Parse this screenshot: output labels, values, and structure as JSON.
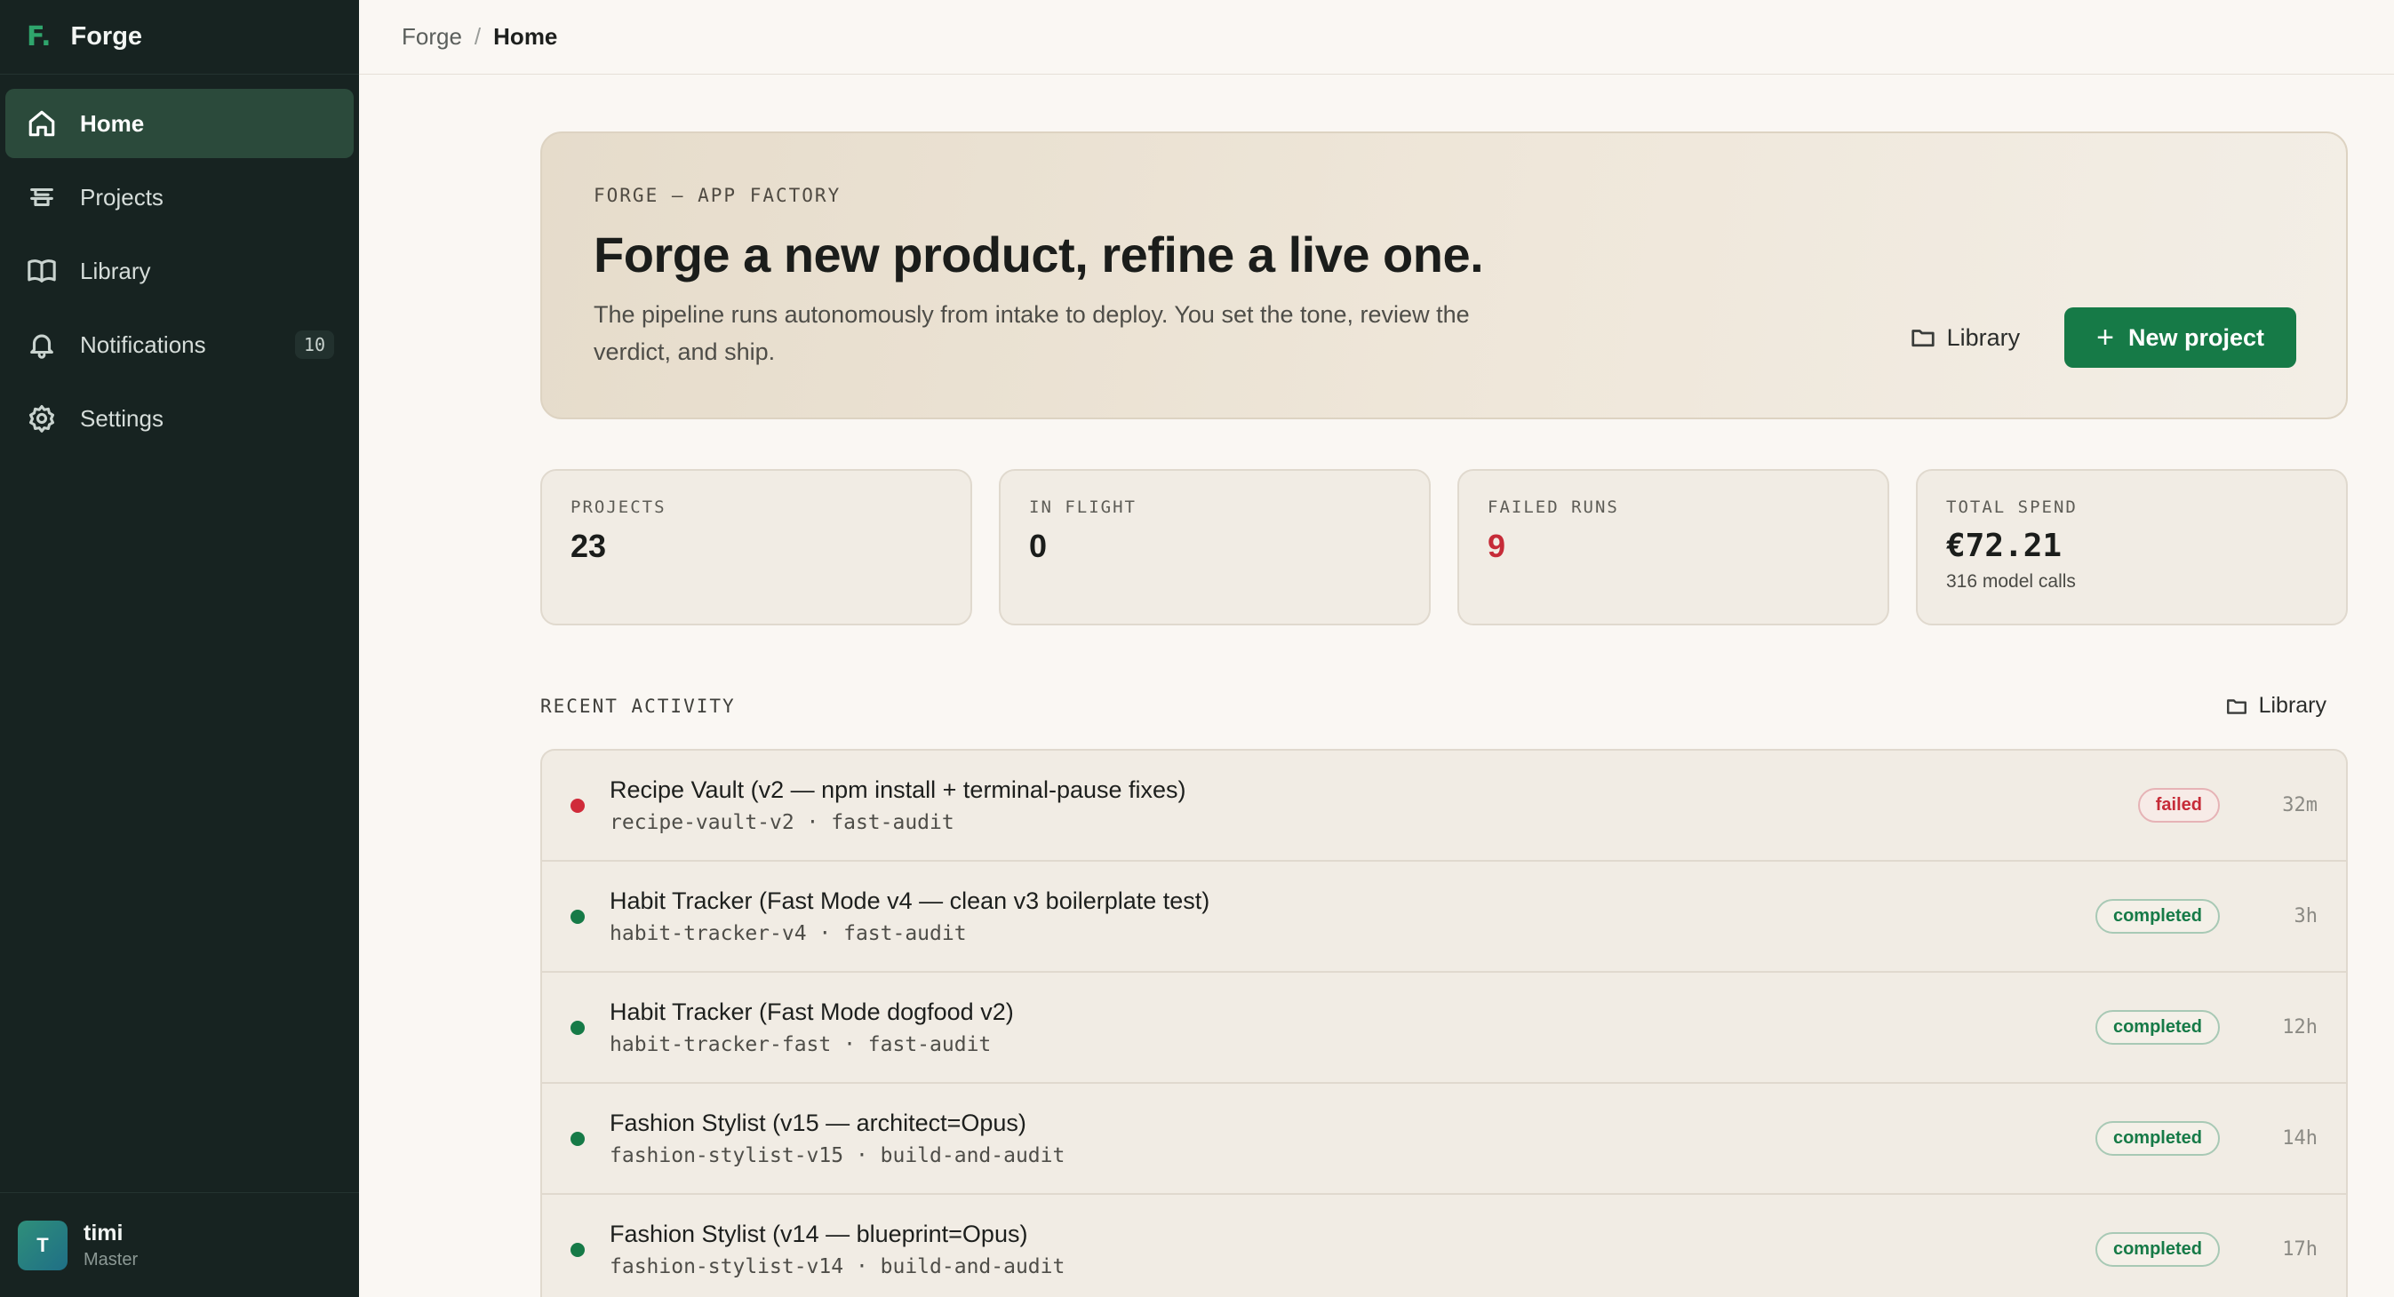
{
  "app": {
    "name": "Forge",
    "mark": "F."
  },
  "breadcrumb": {
    "root": "Forge",
    "separator": "/",
    "current": "Home"
  },
  "sidebar": {
    "items": [
      {
        "label": "Home",
        "icon": "home-icon",
        "active": true
      },
      {
        "label": "Projects",
        "icon": "layers-icon"
      },
      {
        "label": "Library",
        "icon": "book-icon"
      },
      {
        "label": "Notifications",
        "icon": "bell-icon",
        "badge": "10"
      },
      {
        "label": "Settings",
        "icon": "gear-icon"
      }
    ]
  },
  "user": {
    "initial": "T",
    "name": "timi",
    "role": "Master"
  },
  "hero": {
    "kicker": "FORGE — APP FACTORY",
    "title": "Forge a new product, refine a live one.",
    "subtitle": "The pipeline runs autonomously from intake to deploy. You set the tone, review the verdict, and ship.",
    "library_label": "Library",
    "new_project_label": "New project"
  },
  "stats": [
    {
      "label": "PROJECTS",
      "value": "23"
    },
    {
      "label": "IN FLIGHT",
      "value": "0"
    },
    {
      "label": "FAILED RUNS",
      "value": "9"
    },
    {
      "label": "TOTAL SPEND",
      "value": "€72.21",
      "sub": "316 model calls"
    }
  ],
  "activity": {
    "title": "RECENT ACTIVITY",
    "library_label": "Library",
    "rows": [
      {
        "title": "Recipe Vault (v2 — npm install + terminal-pause fixes)",
        "meta": "recipe-vault-v2 · fast-audit",
        "status": "failed",
        "age": "32m"
      },
      {
        "title": "Habit Tracker (Fast Mode v4 — clean v3 boilerplate test)",
        "meta": "habit-tracker-v4 · fast-audit",
        "status": "completed",
        "age": "3h"
      },
      {
        "title": "Habit Tracker (Fast Mode dogfood v2)",
        "meta": "habit-tracker-fast · fast-audit",
        "status": "completed",
        "age": "12h"
      },
      {
        "title": "Fashion Stylist (v15 — architect=Opus)",
        "meta": "fashion-stylist-v15 · build-and-audit",
        "status": "completed",
        "age": "14h"
      },
      {
        "title": "Fashion Stylist (v14 — blueprint=Opus)",
        "meta": "fashion-stylist-v14 · build-and-audit",
        "status": "completed",
        "age": "17h"
      }
    ]
  },
  "colors": {
    "sidebar": "#172321",
    "accent": "#167a47",
    "danger": "#c62b38",
    "background": "#faf7f3"
  }
}
